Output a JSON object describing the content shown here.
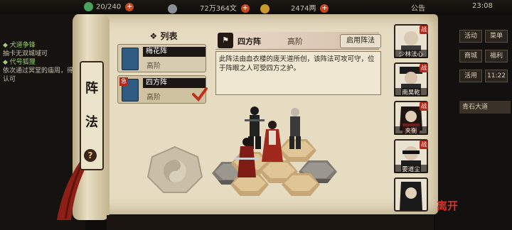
{
  "topbar": {
    "stamina": "20/240",
    "silver": "72万364文",
    "gold": "2474两",
    "announcement": "公告",
    "time": "23:08"
  },
  "quests": [
    {
      "title": "◆ 犬道争锋",
      "text": "抽卡无双城域可"
    },
    {
      "title": "◆ 代号狐狸",
      "text": "依次通过冥堂的庙周，得到认可"
    }
  ],
  "right_buttons": [
    "活动",
    "菜单",
    "商城",
    "福利",
    "活用",
    "11:22"
  ],
  "right_note": "青石大道",
  "tab_label": [
    "阵",
    "法"
  ],
  "list_title": "列表",
  "formations": [
    {
      "name": "梅花阵",
      "level": "高阶",
      "badge": "",
      "selected": false
    },
    {
      "name": "四方阵",
      "level": "高阶",
      "badge": "急",
      "selected": true
    }
  ],
  "detail": {
    "name": "四方阵",
    "level": "高阶",
    "enable_button": "启用阵法",
    "description": "此阵法由血衣楼的庞天道所创，该阵法可攻可守，位于阵眼之人可受四方之护。"
  },
  "portraits": [
    {
      "name": "少林法心",
      "mark": "战",
      "color": "#3a3a3a"
    },
    {
      "name": "南昊乾",
      "mark": "战",
      "color": "#2b2b2b"
    },
    {
      "name": "夹衡",
      "mark": "战",
      "color": "#6b1e1e"
    },
    {
      "name": "要道尘",
      "mark": "战",
      "color": "#1e1e1e"
    },
    {
      "name": "",
      "mark": "",
      "color": "#242424"
    }
  ],
  "leave_label": "离开",
  "colors": {
    "accent_red": "#b02a1c",
    "scroll": "#e6dcc1",
    "hex_tan": "#c7a776",
    "hex_gray": "#7f7b74"
  }
}
